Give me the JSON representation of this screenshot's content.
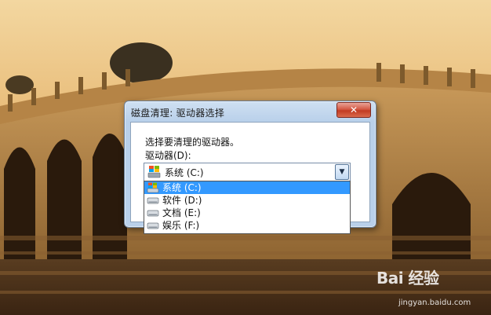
{
  "dialog": {
    "title": "磁盘清理: 驱动器选择",
    "close_label": "✕",
    "prompt": "选择要清理的驱动器。",
    "drive_label": "驱动器(D):"
  },
  "combo": {
    "selected": "系统 (C:)",
    "dropdown_arrow": "▼"
  },
  "drives": [
    {
      "label": "系统 (C:)",
      "icon": "windows-drive-icon",
      "selected": true
    },
    {
      "label": "软件 (D:)",
      "icon": "hard-drive-icon",
      "selected": false
    },
    {
      "label": "文档 (E:)",
      "icon": "hard-drive-icon",
      "selected": false
    },
    {
      "label": "娱乐 (F:)",
      "icon": "hard-drive-icon",
      "selected": false
    }
  ],
  "watermark": {
    "logo": "Bai 经验",
    "url": "jingyan.baidu.com"
  },
  "colors": {
    "selection": "#3399ff",
    "close": "#c23b22",
    "sky": "#e8b868"
  }
}
